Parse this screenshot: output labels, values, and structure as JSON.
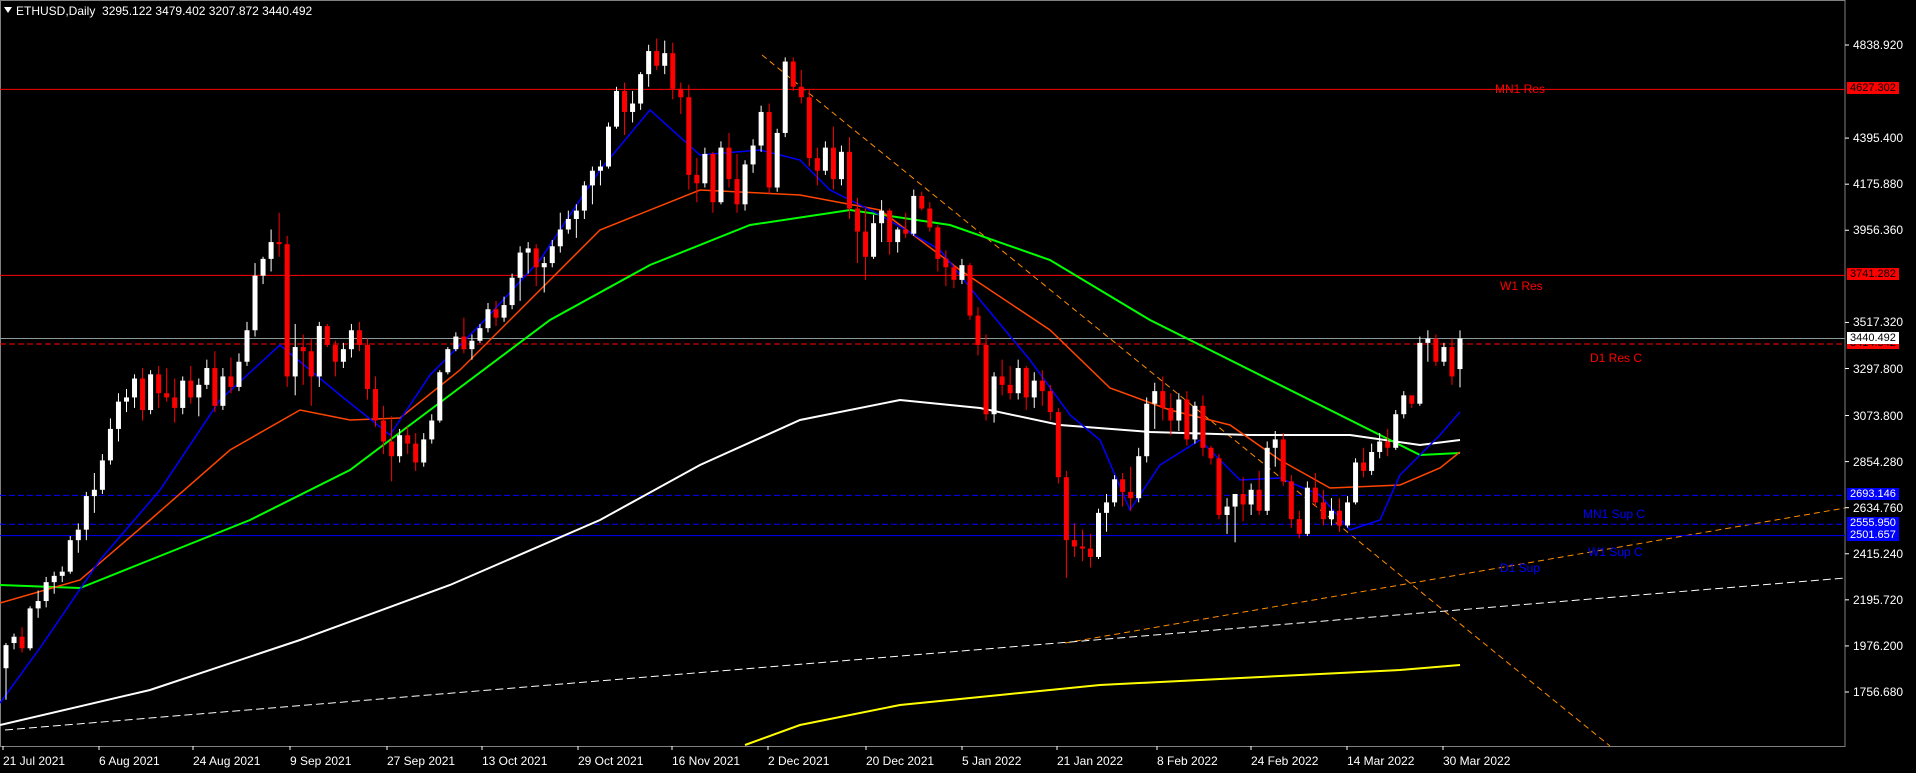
{
  "header": {
    "symbol_timeframe": "ETHUSD,Daily",
    "ohlc": "3295.122 3479.402 3207.872 3440.492"
  },
  "colors": {
    "background": "#000000",
    "bull_candle": "#ffffff",
    "bear_candle": "#ff0000",
    "resistance": "#ff0000",
    "support": "#0000ff",
    "ma_blue": "#0000ff",
    "ma_orange": "#ff4500",
    "ma_green": "#00ff00",
    "ma_white": "#ffffff",
    "ma_yellow": "#ffff00",
    "trendline_orange": "#ff8c00",
    "trendline_white": "#ffffff"
  },
  "price_axis": {
    "ticks": [
      "4838.920",
      "4395.400",
      "4175.880",
      "3956.360",
      "3517.320",
      "3297.800",
      "3073.800",
      "2854.280",
      "2634.760",
      "2415.240",
      "2195.720",
      "1976.200",
      "1756.680"
    ]
  },
  "date_axis": {
    "labels": [
      "21 Jul 2021",
      "6 Aug 2021",
      "24 Aug 2021",
      "9 Sep 2021",
      "27 Sep 2021",
      "13 Oct 2021",
      "29 Oct 2021",
      "16 Nov 2021",
      "2 Dec 2021",
      "20 Dec 2021",
      "5 Jan 2022",
      "21 Jan 2022",
      "8 Feb 2022",
      "24 Feb 2022",
      "14 Mar 2022",
      "30 Mar 2022"
    ]
  },
  "levels": {
    "mn1_res": {
      "label": "MN1 Res",
      "price": "4627.302"
    },
    "w1_res": {
      "label": "W1 Res",
      "price": "3741.282"
    },
    "d1_res": {
      "label": "D1 Res C",
      "price": "3414.542"
    },
    "current": {
      "price": "3440.492"
    },
    "mn1_sup": {
      "label": "MN1 Sup C",
      "price": "2693.146"
    },
    "w1_sup": {
      "label": "W1 Sup C",
      "price": "2555.950"
    },
    "d1_sup": {
      "label": "D1 Sup",
      "price": "2501.657"
    }
  },
  "chart_data": {
    "type": "candlestick",
    "symbol": "ETHUSD",
    "timeframe": "Daily",
    "y_range": [
      1700,
      4950
    ],
    "ohlc": [
      [
        1870,
        1990,
        1720,
        1980
      ],
      [
        1990,
        2035,
        1960,
        2020
      ],
      [
        2020,
        2065,
        1945,
        1965
      ],
      [
        1965,
        2165,
        1955,
        2155
      ],
      [
        2155,
        2240,
        2110,
        2190
      ],
      [
        2190,
        2305,
        2160,
        2280
      ],
      [
        2280,
        2330,
        2225,
        2310
      ],
      [
        2310,
        2355,
        2280,
        2330
      ],
      [
        2330,
        2500,
        2320,
        2480
      ],
      [
        2480,
        2560,
        2420,
        2530
      ],
      [
        2530,
        2710,
        2480,
        2690
      ],
      [
        2690,
        2800,
        2610,
        2720
      ],
      [
        2720,
        2890,
        2700,
        2860
      ],
      [
        2860,
        3060,
        2840,
        3010
      ],
      [
        3010,
        3180,
        2950,
        3140
      ],
      [
        3140,
        3200,
        3090,
        3160
      ],
      [
        3160,
        3270,
        3110,
        3250
      ],
      [
        3250,
        3300,
        3050,
        3100
      ],
      [
        3100,
        3290,
        3080,
        3270
      ],
      [
        3270,
        3310,
        3110,
        3180
      ],
      [
        3180,
        3300,
        3140,
        3160
      ],
      [
        3160,
        3250,
        3040,
        3110
      ],
      [
        3110,
        3260,
        3080,
        3240
      ],
      [
        3240,
        3310,
        3130,
        3160
      ],
      [
        3160,
        3250,
        3070,
        3220
      ],
      [
        3220,
        3340,
        3200,
        3300
      ],
      [
        3300,
        3380,
        3090,
        3120
      ],
      [
        3120,
        3300,
        3100,
        3260
      ],
      [
        3260,
        3350,
        3180,
        3210
      ],
      [
        3210,
        3370,
        3190,
        3330
      ],
      [
        3330,
        3520,
        3310,
        3480
      ],
      [
        3480,
        3800,
        3450,
        3740
      ],
      [
        3740,
        3830,
        3700,
        3820
      ],
      [
        3820,
        3960,
        3760,
        3900
      ],
      [
        3900,
        4040,
        3830,
        3890
      ],
      [
        3890,
        3930,
        3210,
        3260
      ],
      [
        3260,
        3510,
        3170,
        3400
      ],
      [
        3400,
        3460,
        3220,
        3380
      ],
      [
        3380,
        3440,
        3120,
        3260
      ],
      [
        3260,
        3520,
        3210,
        3500
      ],
      [
        3500,
        3510,
        3400,
        3410
      ],
      [
        3410,
        3430,
        3260,
        3330
      ],
      [
        3330,
        3420,
        3300,
        3390
      ],
      [
        3390,
        3510,
        3350,
        3480
      ],
      [
        3480,
        3520,
        3380,
        3410
      ],
      [
        3410,
        3440,
        3150,
        3200
      ],
      [
        3200,
        3260,
        3020,
        3050
      ],
      [
        3050,
        3120,
        2890,
        2950
      ],
      [
        2950,
        3070,
        2760,
        2880
      ],
      [
        2880,
        3010,
        2850,
        2980
      ],
      [
        2980,
        3020,
        2890,
        2940
      ],
      [
        2940,
        2990,
        2810,
        2850
      ],
      [
        2850,
        2990,
        2830,
        2960
      ],
      [
        2960,
        3080,
        2940,
        3050
      ],
      [
        3050,
        3290,
        3040,
        3280
      ],
      [
        3280,
        3400,
        3270,
        3390
      ],
      [
        3390,
        3470,
        3380,
        3450
      ],
      [
        3450,
        3540,
        3370,
        3390
      ],
      [
        3390,
        3460,
        3340,
        3430
      ],
      [
        3430,
        3510,
        3420,
        3490
      ],
      [
        3490,
        3610,
        3470,
        3580
      ],
      [
        3580,
        3620,
        3500,
        3540
      ],
      [
        3540,
        3640,
        3520,
        3600
      ],
      [
        3600,
        3750,
        3580,
        3730
      ],
      [
        3730,
        3880,
        3620,
        3850
      ],
      [
        3850,
        3900,
        3750,
        3870
      ],
      [
        3870,
        3890,
        3690,
        3780
      ],
      [
        3780,
        3830,
        3660,
        3800
      ],
      [
        3800,
        3910,
        3780,
        3880
      ],
      [
        3880,
        4040,
        3850,
        3960
      ],
      [
        3960,
        4050,
        3940,
        4010
      ],
      [
        4010,
        4080,
        3920,
        4050
      ],
      [
        4050,
        4190,
        4010,
        4170
      ],
      [
        4170,
        4260,
        4080,
        4240
      ],
      [
        4240,
        4290,
        4170,
        4260
      ],
      [
        4260,
        4470,
        4250,
        4450
      ],
      [
        4450,
        4640,
        4440,
        4620
      ],
      [
        4620,
        4660,
        4410,
        4520
      ],
      [
        4520,
        4620,
        4470,
        4560
      ],
      [
        4560,
        4710,
        4530,
        4700
      ],
      [
        4700,
        4840,
        4640,
        4810
      ],
      [
        4810,
        4870,
        4720,
        4740
      ],
      [
        4740,
        4860,
        4700,
        4800
      ],
      [
        4800,
        4850,
        4580,
        4630
      ],
      [
        4630,
        4660,
        4510,
        4590
      ],
      [
        4590,
        4650,
        4150,
        4220
      ],
      [
        4220,
        4300,
        4090,
        4180
      ],
      [
        4180,
        4350,
        4160,
        4320
      ],
      [
        4320,
        4330,
        4040,
        4090
      ],
      [
        4090,
        4380,
        4080,
        4350
      ],
      [
        4350,
        4420,
        4160,
        4200
      ],
      [
        4200,
        4320,
        4040,
        4080
      ],
      [
        4080,
        4290,
        4050,
        4270
      ],
      [
        4270,
        4390,
        4230,
        4360
      ],
      [
        4360,
        4550,
        4330,
        4520
      ],
      [
        4520,
        4560,
        4130,
        4160
      ],
      [
        4160,
        4440,
        4140,
        4420
      ],
      [
        4420,
        4780,
        4400,
        4760
      ],
      [
        4760,
        4780,
        4620,
        4640
      ],
      [
        4640,
        4720,
        4560,
        4590
      ],
      [
        4590,
        4630,
        4260,
        4300
      ],
      [
        4300,
        4350,
        4170,
        4240
      ],
      [
        4240,
        4380,
        4220,
        4350
      ],
      [
        4350,
        4450,
        4150,
        4200
      ],
      [
        4200,
        4360,
        4170,
        4330
      ],
      [
        4330,
        4400,
        4010,
        4060
      ],
      [
        4060,
        4110,
        3800,
        3950
      ],
      [
        3950,
        4060,
        3720,
        3830
      ],
      [
        3830,
        4030,
        3820,
        3990
      ],
      [
        3990,
        4100,
        3900,
        4050
      ],
      [
        4050,
        4060,
        3840,
        3900
      ],
      [
        3900,
        3970,
        3850,
        3960
      ],
      [
        3960,
        4040,
        3920,
        3940
      ],
      [
        3940,
        4150,
        3930,
        4120
      ],
      [
        4120,
        4140,
        4050,
        4060
      ],
      [
        4060,
        4090,
        3950,
        3970
      ],
      [
        3970,
        3980,
        3760,
        3820
      ],
      [
        3820,
        3860,
        3690,
        3780
      ],
      [
        3780,
        3790,
        3680,
        3720
      ],
      [
        3720,
        3820,
        3700,
        3790
      ],
      [
        3790,
        3800,
        3530,
        3550
      ],
      [
        3550,
        3590,
        3360,
        3410
      ],
      [
        3410,
        3460,
        3050,
        3080
      ],
      [
        3080,
        3280,
        3040,
        3260
      ],
      [
        3260,
        3340,
        3170,
        3220
      ],
      [
        3220,
        3310,
        3150,
        3180
      ],
      [
        3180,
        3340,
        3150,
        3300
      ],
      [
        3300,
        3310,
        3100,
        3160
      ],
      [
        3160,
        3280,
        3110,
        3240
      ],
      [
        3240,
        3290,
        3120,
        3190
      ],
      [
        3190,
        3220,
        3050,
        3090
      ],
      [
        3090,
        3110,
        2750,
        2780
      ],
      [
        2780,
        2810,
        2300,
        2480
      ],
      [
        2480,
        2560,
        2400,
        2450
      ],
      [
        2450,
        2530,
        2380,
        2440
      ],
      [
        2440,
        2510,
        2350,
        2400
      ],
      [
        2400,
        2630,
        2390,
        2610
      ],
      [
        2610,
        2700,
        2520,
        2660
      ],
      [
        2660,
        2790,
        2640,
        2770
      ],
      [
        2770,
        2800,
        2640,
        2710
      ],
      [
        2710,
        2830,
        2620,
        2680
      ],
      [
        2680,
        2920,
        2660,
        2880
      ],
      [
        2880,
        3160,
        2850,
        3130
      ],
      [
        3130,
        3230,
        3010,
        3190
      ],
      [
        3190,
        3260,
        3050,
        3110
      ],
      [
        3110,
        3180,
        2980,
        3050
      ],
      [
        3050,
        3180,
        3000,
        3150
      ],
      [
        3150,
        3190,
        2930,
        2960
      ],
      [
        2960,
        3140,
        2940,
        3120
      ],
      [
        3120,
        3170,
        2880,
        2920
      ],
      [
        2920,
        2930,
        2840,
        2870
      ],
      [
        2870,
        2890,
        2580,
        2600
      ],
      [
        2600,
        2680,
        2510,
        2640
      ],
      [
        2640,
        2700,
        2470,
        2700
      ],
      [
        2700,
        2780,
        2570,
        2650
      ],
      [
        2650,
        2750,
        2600,
        2720
      ],
      [
        2720,
        2810,
        2600,
        2620
      ],
      [
        2620,
        2950,
        2600,
        2920
      ],
      [
        2920,
        3000,
        2830,
        2960
      ],
      [
        2960,
        2990,
        2740,
        2760
      ],
      [
        2760,
        2790,
        2540,
        2580
      ],
      [
        2580,
        2620,
        2490,
        2510
      ],
      [
        2510,
        2760,
        2500,
        2730
      ],
      [
        2730,
        2800,
        2640,
        2660
      ],
      [
        2660,
        2720,
        2550,
        2580
      ],
      [
        2580,
        2680,
        2550,
        2620
      ],
      [
        2620,
        2680,
        2520,
        2550
      ],
      [
        2550,
        2690,
        2540,
        2660
      ],
      [
        2660,
        2870,
        2650,
        2850
      ],
      [
        2850,
        2920,
        2780,
        2810
      ],
      [
        2810,
        2940,
        2790,
        2900
      ],
      [
        2900,
        2990,
        2870,
        2950
      ],
      [
        2950,
        3010,
        2880,
        2920
      ],
      [
        2920,
        3100,
        2910,
        3080
      ],
      [
        3080,
        3190,
        3060,
        3170
      ],
      [
        3170,
        3150,
        3110,
        3130
      ],
      [
        3130,
        3450,
        3120,
        3420
      ],
      [
        3420,
        3480,
        3330,
        3440
      ],
      [
        3440,
        3460,
        3310,
        3330
      ],
      [
        3330,
        3420,
        3310,
        3400
      ],
      [
        3400,
        3440,
        3220,
        3260
      ],
      [
        3295.122,
        3479.402,
        3207.872,
        3440.492
      ]
    ]
  }
}
